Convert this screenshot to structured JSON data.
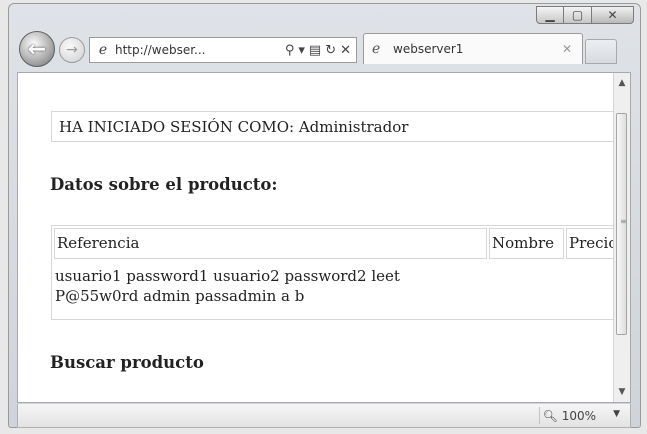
{
  "browser": {
    "address_url": "http://webser...",
    "tab_title": "webserver1",
    "zoom_label": "100%"
  },
  "page": {
    "session_text": "HA INICIADO SESIÓN COMO: Administrador",
    "product_heading": "Datos sobre el producto:",
    "table": {
      "headers": [
        "Referencia",
        "Nombre",
        "Precio"
      ],
      "data_line1": "usuario1 password1 usuario2 password2 leet",
      "data_line2": "P@55w0rd admin passadmin a b"
    },
    "search_heading": "Buscar producto"
  },
  "icons": {
    "back": "back-arrow-icon",
    "forward": "forward-arrow-icon",
    "site": "ie-page-icon",
    "search": "search-icon",
    "refresh": "refresh-icon",
    "stop": "stop-icon",
    "zoom": "zoom-icon"
  }
}
